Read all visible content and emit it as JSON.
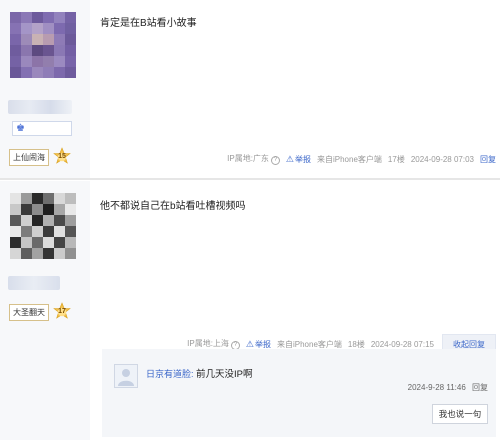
{
  "posts": [
    {
      "content": "肯定是在B站看小故事",
      "grade_name": "上仙闹海",
      "grade_level": "15",
      "ip_label": "IP属地:广东",
      "report": "举报",
      "client": "来自iPhone客户端",
      "floor": "17楼",
      "time": "2024-09-28 07:03",
      "reply": "回复"
    },
    {
      "content": "他不都说自己在b站看吐槽视频吗",
      "grade_name": "大圣翻天",
      "grade_level": "17",
      "ip_label": "IP属地:上海",
      "report": "举报",
      "client": "来自iPhone客户端",
      "floor": "18楼",
      "time": "2024-09-28 07:15",
      "collapse_reply": "收起回复",
      "sub_reply": {
        "user": "日京有道脸:",
        "text": "前几天没IP啊",
        "time": "2024-9-28 11:46",
        "reply": "回复",
        "say_button": "我也说一句"
      }
    }
  ],
  "colors": {
    "link_blue": "#3a66c9",
    "author_bg": "#f7f8fa",
    "grade_badge": "#f3c04a"
  }
}
